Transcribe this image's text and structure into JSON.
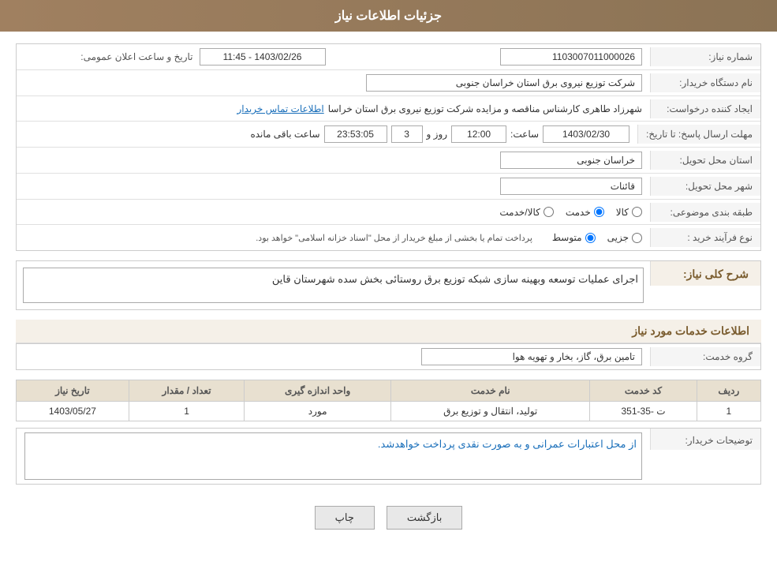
{
  "page": {
    "title": "جزئیات اطلاعات نیاز"
  },
  "header": {
    "title": "جزئیات اطلاعات نیاز"
  },
  "fields": {
    "need_number_label": "شماره نیاز:",
    "need_number_value": "1103007011000026",
    "announce_datetime_label": "تاریخ و ساعت اعلان عمومی:",
    "announce_datetime_value": "1403/02/26 - 11:45",
    "buyer_name_label": "نام دستگاه خریدار:",
    "buyer_name_value": "شرکت توزیع نیروی برق استان خراسان جنوبی",
    "creator_label": "ایجاد کننده درخواست:",
    "creator_value": "شهرزاد طاهری کارشناس مناقصه و مزایده شرکت توزیع نیروی برق استان خراسا",
    "contact_link": "اطلاعات تماس خریدار",
    "reply_deadline_label": "مهلت ارسال پاسخ: تا تاریخ:",
    "reply_date": "1403/02/30",
    "reply_time_label": "ساعت:",
    "reply_time": "12:00",
    "reply_day_label": "روز و",
    "reply_day": "3",
    "reply_remaining_label": "ساعت باقی مانده",
    "reply_remaining": "23:53:05",
    "delivery_province_label": "استان محل تحویل:",
    "delivery_province_value": "خراسان جنوبی",
    "delivery_city_label": "شهر محل تحویل:",
    "delivery_city_value": "قائنات",
    "category_label": "طبقه بندی موضوعی:",
    "category_radio_options": [
      "کالا",
      "خدمت",
      "کالا/خدمت"
    ],
    "category_selected": "خدمت",
    "purchase_type_label": "نوع فرآیند خرید :",
    "purchase_type_options": [
      "جزیی",
      "متوسط"
    ],
    "purchase_type_note": "پرداخت تمام یا بخشی از مبلغ خریدار از محل \"اسناد خزانه اسلامی\" خواهد بود.",
    "description_label": "شرح کلی نیاز:",
    "description_value": "اجرای عملیات توسعه وبهینه سازی شبکه توزیع برق روستائی بخش سده شهرستان قاین",
    "service_info_header": "اطلاعات خدمات مورد نیاز",
    "service_group_label": "گروه خدمت:",
    "service_group_value": "تامین برق، گاز، بخار و تهویه هوا",
    "table_headers": [
      "ردیف",
      "کد خدمت",
      "نام خدمت",
      "واحد اندازه گیری",
      "تعداد / مقدار",
      "تاریخ نیاز"
    ],
    "table_rows": [
      {
        "row": "1",
        "service_code": "ت -35-351",
        "service_name": "تولید، انتقال و توزیع برق",
        "unit": "مورد",
        "quantity": "1",
        "date": "1403/05/27"
      }
    ],
    "buyer_notes_label": "توضیحات خریدار:",
    "buyer_notes_value": "از محل اعتبارات عمرانی و به صورت نقدی پرداخت خواهدشد."
  },
  "buttons": {
    "print_label": "چاپ",
    "back_label": "بازگشت"
  }
}
